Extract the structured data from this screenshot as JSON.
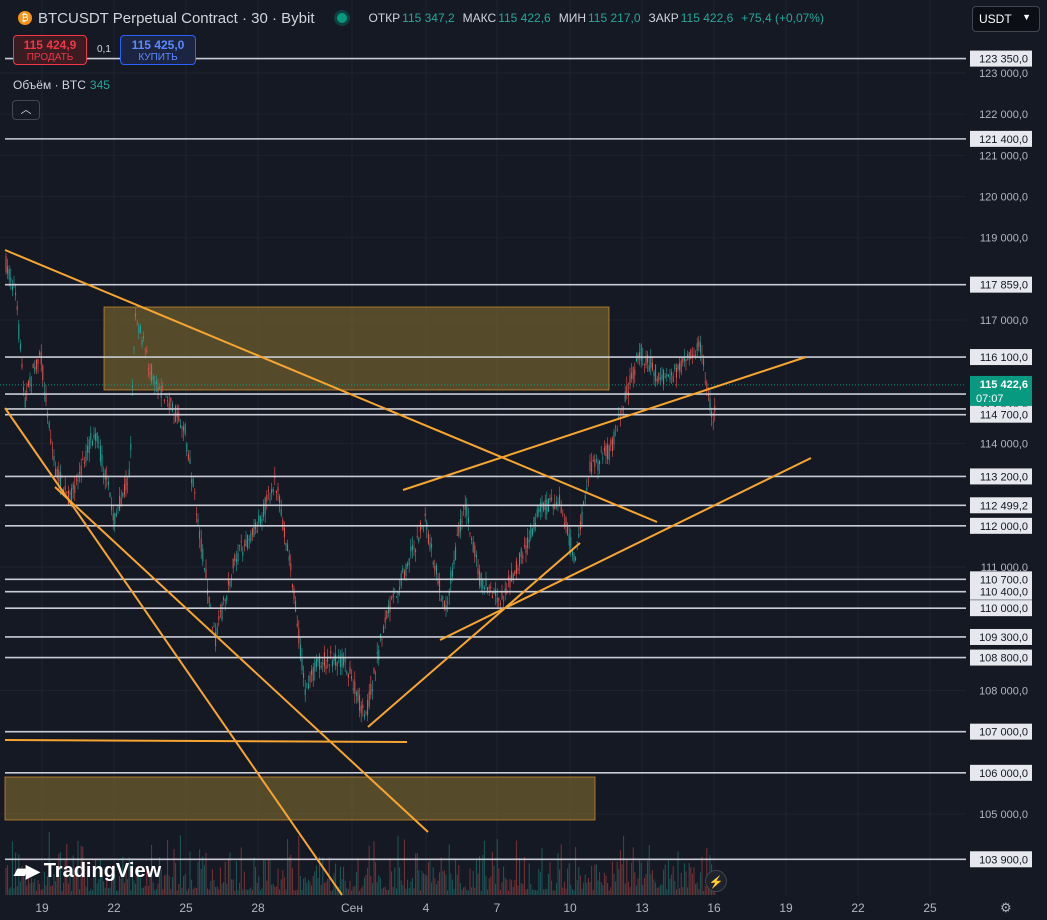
{
  "header": {
    "title": "BTCUSDT Perpetual Contract · 30 · Bybit",
    "open_label": "ОТКР",
    "open": "115 347,2",
    "high_label": "МАКС",
    "high": "115 422,6",
    "low_label": "МИН",
    "low": "115 217,0",
    "close_label": "ЗАКР",
    "close": "115 422,6",
    "change": "+75,4 (+0,07%)"
  },
  "trade": {
    "sell_price": "115 424,9",
    "sell_label": "ПРОДАТЬ",
    "spread": "0,1",
    "buy_price": "115 425,0",
    "buy_label": "КУПИТЬ"
  },
  "volume": {
    "label": "Объём · BTC",
    "value": "345"
  },
  "currency": "USDT",
  "brand": "TradingView",
  "price_axis": {
    "ticks": [
      "123 000,0",
      "122 000,0",
      "121 000,0",
      "120 000,0",
      "119 000,0",
      "117 000,0",
      "114 000,0",
      "111 000,0",
      "108 000,0",
      "105 000,0"
    ],
    "levels": [
      "123 350,0",
      "121 400,0",
      "117 859,0",
      "116 100,0",
      "115 200,0",
      "114 840,0",
      "114 700,0",
      "113 200,0",
      "112 499,2",
      "112 000,0",
      "110 700,0",
      "110 400,0",
      "110 000,0",
      "109 300,0",
      "108 800,0",
      "107 000,0",
      "106 000,0",
      "103 900,0"
    ],
    "current_price": "115 422,6",
    "countdown": "07:07"
  },
  "time_axis": [
    "19",
    "22",
    "25",
    "28",
    "Сен",
    "4",
    "7",
    "10",
    "13",
    "16",
    "19",
    "22",
    "25"
  ],
  "colors": {
    "background": "#151924",
    "trendline": "#f7a531",
    "zone": "#8a7230",
    "up": "#26a69a",
    "down": "#ef5350",
    "level": "#c9ccd4",
    "current": "#089981"
  }
}
